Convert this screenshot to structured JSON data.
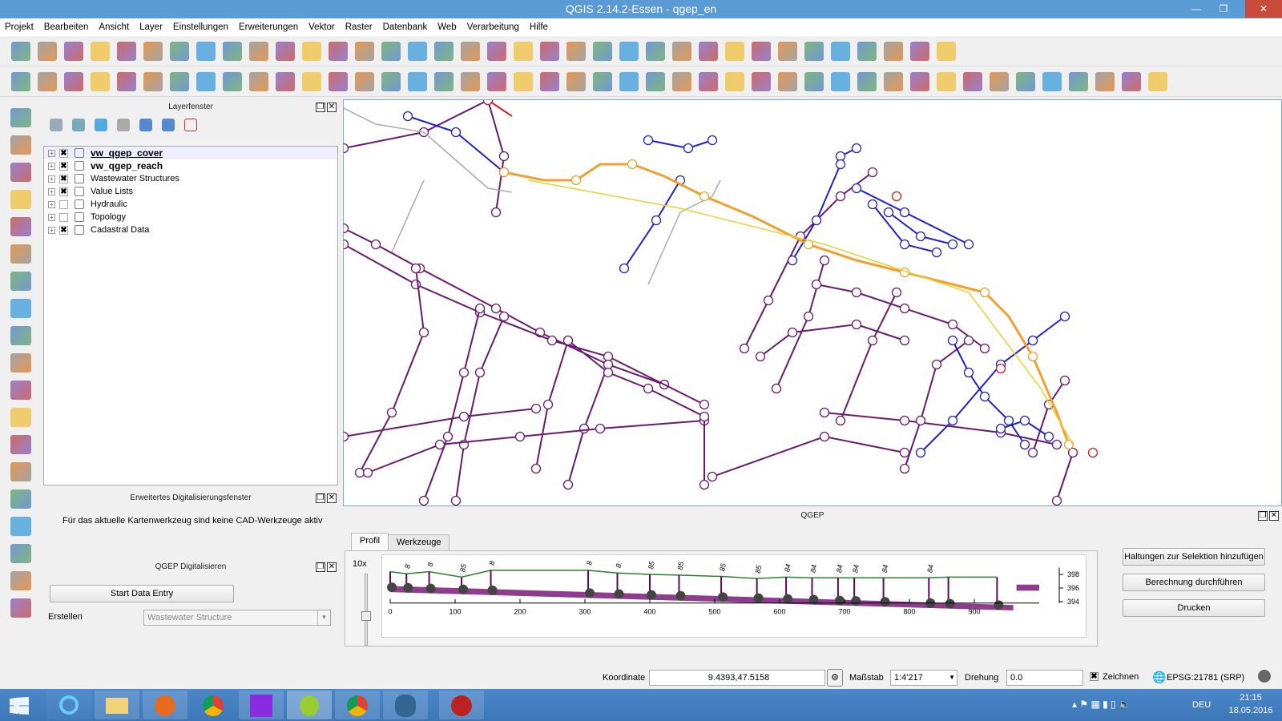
{
  "window": {
    "title": "QGIS 2.14.2-Essen - qgep_en"
  },
  "menu": [
    "Projekt",
    "Bearbeiten",
    "Ansicht",
    "Layer",
    "Einstellungen",
    "Erweiterungen",
    "Vektor",
    "Raster",
    "Datenbank",
    "Web",
    "Verarbeitung",
    "Hilfe"
  ],
  "layer_panel": {
    "title": "Layerfenster",
    "layers": [
      {
        "name": "vw_qgep_cover",
        "checked": true,
        "bold": true,
        "underline": true
      },
      {
        "name": "vw_qgep_reach",
        "checked": true,
        "bold": true
      },
      {
        "name": "Wastewater Structures",
        "checked": true
      },
      {
        "name": "Value Lists",
        "checked": true
      },
      {
        "name": "Hydraulic",
        "checked": false
      },
      {
        "name": "Topology",
        "checked": false
      },
      {
        "name": "Cadastral Data",
        "checked": true
      }
    ]
  },
  "adv_digitizing": {
    "title": "Erweitertes Digitalisierungsfenster",
    "message": "Für das aktuelle Kartenwerkzeug sind keine CAD-Werkzeuge aktiv"
  },
  "qgep_digitize": {
    "title": "QGEP Digitalisieren",
    "start_button": "Start Data Entry",
    "create_label": "Erstellen",
    "create_value": "Wastewater Structure"
  },
  "qgep_panel": {
    "title": "QGEP",
    "tabs": [
      "Profil",
      "Werkzeuge"
    ],
    "active_tab": "Profil",
    "zoom_label": "10x",
    "buttons": [
      "Haltungen zur Selektion hinzufügen",
      "Berechnung durchführen",
      "Drucken"
    ]
  },
  "chart_data": {
    "type": "line",
    "x_ticks": [
      0,
      100,
      200,
      300,
      400,
      500,
      600,
      700,
      800,
      900
    ],
    "y_ticks": [
      394,
      396,
      398
    ],
    "node_labels": [
      "8",
      "8",
      "85",
      "8",
      "8",
      "8:",
      "85",
      "85",
      "85",
      "85",
      "84",
      "84",
      "84",
      "84",
      "84",
      "84"
    ],
    "ground": {
      "x": [
        0,
        25,
        60,
        110,
        155,
        305,
        350,
        400,
        445,
        510,
        565,
        610,
        650,
        690,
        715,
        760,
        830,
        860,
        935
      ],
      "y": [
        398.4,
        398.1,
        398.4,
        397.6,
        398.6,
        398.6,
        398.2,
        398.0,
        397.9,
        397.7,
        397.4,
        397.6,
        397.5,
        397.5,
        397.5,
        397.5,
        397.5,
        397.6,
        397.6
      ]
    }
  },
  "statusbar": {
    "coord_label": "Koordinate",
    "coord_value": "9.4393,47.5158",
    "scale_label": "Maßstab",
    "scale_value": "1:4'217",
    "rotation_label": "Drehung",
    "rotation_value": "0.0",
    "render_label": "Zeichnen",
    "render_checked": true,
    "crs": "EPSG:21781 (SRP)"
  },
  "taskbar": {
    "lang": "DEU",
    "time": "21:15",
    "date": "18.05.2016"
  },
  "colors": {
    "reach": "#6a1a6e",
    "selected": "#f0a030",
    "highlight": "#2020c8",
    "accent": "#5b9bd5"
  }
}
